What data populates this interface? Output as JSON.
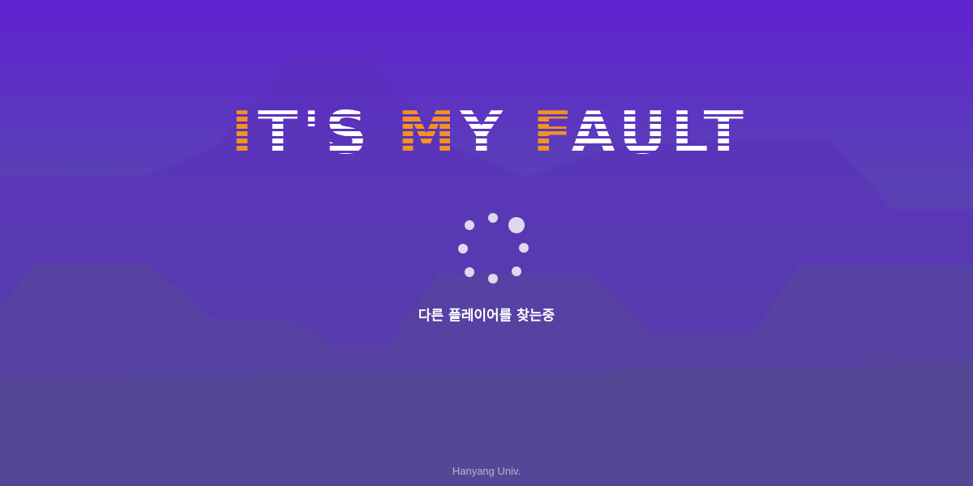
{
  "title": {
    "segments": [
      {
        "text": "I",
        "color": "#f5921e"
      },
      {
        "text": "T'S ",
        "color": "#ffffff"
      },
      {
        "text": "M",
        "color": "#f5921e"
      },
      {
        "text": "Y ",
        "color": "#ffffff"
      },
      {
        "text": "F",
        "color": "#f5921e"
      },
      {
        "text": "AULT",
        "color": "#ffffff"
      }
    ]
  },
  "loading": {
    "status_text": "다른 플레이어를 찾는중",
    "spinner_icon": "loading-spinner-icon"
  },
  "footer": {
    "text": "Hanyang Univ."
  },
  "colors": {
    "accent": "#f5921e",
    "text": "#ffffff",
    "bg_top": "#6122d0",
    "bg_bottom": "#534f88"
  }
}
